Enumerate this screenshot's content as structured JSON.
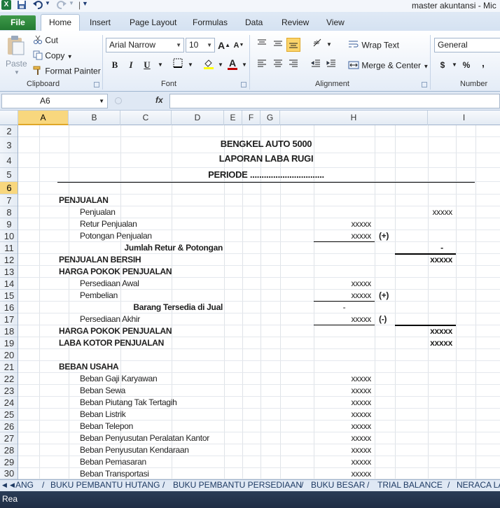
{
  "window": {
    "title": "master akuntansi  -  Mic",
    "app_icon": "X",
    "quick_access": [
      "save-icon",
      "undo-icon",
      "redo-icon",
      "customize-icon"
    ]
  },
  "ribbon_tabs": [
    "File",
    "Home",
    "Insert",
    "Page Layout",
    "Formulas",
    "Data",
    "Review",
    "View"
  ],
  "clipboard": {
    "paste": "Paste",
    "cut": "Cut",
    "copy": "Copy",
    "format_painter": "Format Painter",
    "group": "Clipboard"
  },
  "font": {
    "name": "Arial Narrow",
    "size": "10",
    "bold": "B",
    "italic": "I",
    "underline": "U",
    "group": "Font",
    "fill_color": "#ffff00",
    "font_color": "#c00000"
  },
  "alignment": {
    "wrap_text": "Wrap Text",
    "merge_center": "Merge & Center",
    "group": "Alignment"
  },
  "number": {
    "format": "General",
    "currency": "$",
    "percent": "%",
    "comma": ",",
    "group": "Number"
  },
  "formula_bar": {
    "name_box": "A6",
    "fx": "fx",
    "value": ""
  },
  "columns": [
    "A",
    "B",
    "C",
    "D",
    "E",
    "F",
    "G",
    "H",
    "I"
  ],
  "selected_column": "A",
  "rows": [
    "2",
    "3",
    "4",
    "5",
    "6",
    "7",
    "8",
    "9",
    "10",
    "11",
    "12",
    "13",
    "14",
    "15",
    "16",
    "17",
    "18",
    "19",
    "20",
    "21",
    "22",
    "23",
    "24",
    "25",
    "26",
    "27",
    "28",
    "29",
    "30"
  ],
  "selected_row": "6",
  "report": {
    "title": "BENGKEL AUTO 5000",
    "subtitle": "LAPORAN LABA RUGI",
    "period": "PERIODE ................................",
    "lines": [
      {
        "row": "7",
        "label": "PENJUALAN",
        "indent": 0,
        "bold": true,
        "h": "",
        "mark": "",
        "i": ""
      },
      {
        "row": "8",
        "label": "Penjualan",
        "indent": 1,
        "bold": false,
        "h": "",
        "mark": "",
        "i": "xxxxx"
      },
      {
        "row": "9",
        "label": "Retur Penjualan",
        "indent": 1,
        "bold": false,
        "h": "xxxxx",
        "mark": "",
        "i": ""
      },
      {
        "row": "10",
        "label": "Potongan Penjualan",
        "indent": 1,
        "bold": false,
        "h": "xxxxx",
        "mark": "(+)",
        "i": ""
      },
      {
        "row": "11",
        "label": "Jumlah Retur & Potongan",
        "indent": 2,
        "bold": true,
        "h": "",
        "mark": "",
        "i": "-"
      },
      {
        "row": "12",
        "label": "PENJUALAN BERSIH",
        "indent": 0,
        "bold": true,
        "h": "",
        "mark": "",
        "i": "xxxxx"
      },
      {
        "row": "13",
        "label": "HARGA POKOK PENJUALAN",
        "indent": 0,
        "bold": true,
        "h": "",
        "mark": "",
        "i": ""
      },
      {
        "row": "14",
        "label": "Persediaan Awal",
        "indent": 1,
        "bold": false,
        "h": "xxxxx",
        "mark": "",
        "i": ""
      },
      {
        "row": "15",
        "label": "Pembelian",
        "indent": 1,
        "bold": false,
        "h": "xxxxx",
        "mark": "(+)",
        "i": ""
      },
      {
        "row": "16",
        "label": "Barang Tersedia di Jual",
        "indent": 2,
        "bold": true,
        "h": "-",
        "mark": "",
        "i": ""
      },
      {
        "row": "17",
        "label": "Persediaan Akhir",
        "indent": 1,
        "bold": false,
        "h": "xxxxx",
        "mark": "(-)",
        "i": ""
      },
      {
        "row": "18",
        "label": "HARGA POKOK PENJUALAN",
        "indent": 0,
        "bold": true,
        "h": "",
        "mark": "",
        "i": "xxxxx"
      },
      {
        "row": "19",
        "label": "LABA KOTOR PENJUALAN",
        "indent": 0,
        "bold": true,
        "h": "",
        "mark": "",
        "i": "xxxxx"
      },
      {
        "row": "20",
        "label": "",
        "indent": 0,
        "bold": false,
        "h": "",
        "mark": "",
        "i": ""
      },
      {
        "row": "21",
        "label": "BEBAN USAHA",
        "indent": 0,
        "bold": true,
        "h": "",
        "mark": "",
        "i": ""
      },
      {
        "row": "22",
        "label": "Beban Gaji Karyawan",
        "indent": 1,
        "bold": false,
        "h": "xxxxx",
        "mark": "",
        "i": ""
      },
      {
        "row": "23",
        "label": "Beban Sewa",
        "indent": 1,
        "bold": false,
        "h": "xxxxx",
        "mark": "",
        "i": ""
      },
      {
        "row": "24",
        "label": "Beban Piutang Tak Tertagih",
        "indent": 1,
        "bold": false,
        "h": "xxxxx",
        "mark": "",
        "i": ""
      },
      {
        "row": "25",
        "label": "Beban Listrik",
        "indent": 1,
        "bold": false,
        "h": "xxxxx",
        "mark": "",
        "i": ""
      },
      {
        "row": "26",
        "label": "Beban Telepon",
        "indent": 1,
        "bold": false,
        "h": "xxxxx",
        "mark": "",
        "i": ""
      },
      {
        "row": "27",
        "label": "Beban Penyusutan Peralatan Kantor",
        "indent": 1,
        "bold": false,
        "h": "xxxxx",
        "mark": "",
        "i": ""
      },
      {
        "row": "28",
        "label": "Beban Penyusutan Kendaraan",
        "indent": 1,
        "bold": false,
        "h": "xxxxx",
        "mark": "",
        "i": ""
      },
      {
        "row": "29",
        "label": "Beban Pemasaran",
        "indent": 1,
        "bold": false,
        "h": "xxxxx",
        "mark": "",
        "i": ""
      },
      {
        "row": "30",
        "label": "Beban Transportasi",
        "indent": 1,
        "bold": false,
        "h": "xxxxx",
        "mark": "",
        "i": ""
      }
    ]
  },
  "sheet_tabs": [
    "ANG",
    "BUKU PEMBANTU HUTANG",
    "BUKU PEMBANTU PERSEDIAAN",
    "BUKU BESAR",
    "TRIAL BALANCE",
    "NERACA LA"
  ],
  "status": "Rea"
}
